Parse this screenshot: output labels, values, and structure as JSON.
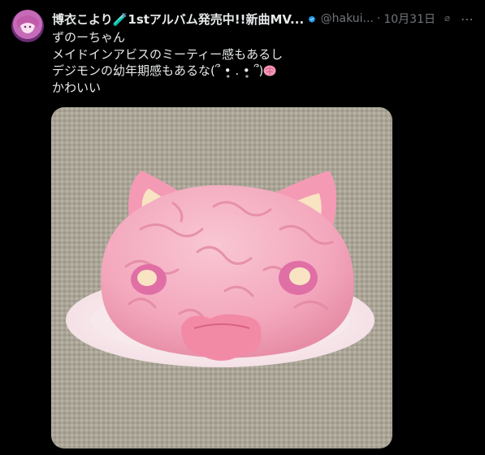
{
  "author": {
    "display_name": "博衣こより🧪1stアルバム発売中!!新曲MV...",
    "handle": "@hakui...",
    "separator": "·",
    "timestamp": "10月31日",
    "verified": true
  },
  "tweet": {
    "lines": [
      "ずのーちゃん",
      "メイドインアビスのミーティー感もあるし",
      "デジモンの幼年期感もあるな(՞ •̥ . •̥ ՞)"
    ],
    "line3_emoji": "brain-icon",
    "line4": "かわいい"
  },
  "icons": {
    "more": "⋯"
  },
  "colors": {
    "background": "#000000",
    "text": "#e7e9ea",
    "muted": "#71767b",
    "verified": "#1d9bf0",
    "cake_pink": "#f3a7bd"
  }
}
